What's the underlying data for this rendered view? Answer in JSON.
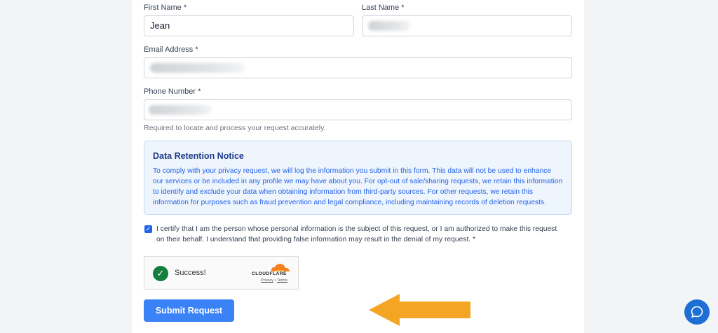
{
  "form": {
    "first_name": {
      "label": "First Name",
      "required_mark": "*",
      "value": "Jean"
    },
    "last_name": {
      "label": "Last Name",
      "required_mark": "*",
      "value": ""
    },
    "email": {
      "label": "Email Address",
      "required_mark": "*",
      "value": ""
    },
    "phone": {
      "label": "Phone Number",
      "required_mark": "*",
      "value": "",
      "hint": "Required to locate and process your request accurately."
    }
  },
  "notice": {
    "title": "Data Retention Notice",
    "body": "To comply with your privacy request, we will log the information you submit in this form. This data will not be used to enhance our services or be included in any profile we may have about you. For opt-out of sale/sharing requests, we retain this information to identify and exclude your data when obtaining information from third-party sources. For other requests, we retain this information for purposes such as fraud prevention and legal compliance, including maintaining records of deletion requests."
  },
  "certification": {
    "checked": true,
    "text": "I certify that I am the person whose personal information is the subject of this request, or I am authorized to make this request on their behalf. I understand that providing false information may result in the denial of my request. *"
  },
  "captcha": {
    "status": "Success!",
    "brand": "CLOUDFLARE",
    "privacy": "Privacy",
    "separator": "•",
    "terms": "Terms"
  },
  "submit_label": "Submit Request",
  "colors": {
    "accent": "#3b82f6",
    "arrow": "#f5a524",
    "success": "#15803d",
    "cloudflare": "#f48120"
  },
  "icons": {
    "chat": "chat-bubble-icon",
    "check": "check-icon",
    "arrow": "arrow-left-icon"
  }
}
